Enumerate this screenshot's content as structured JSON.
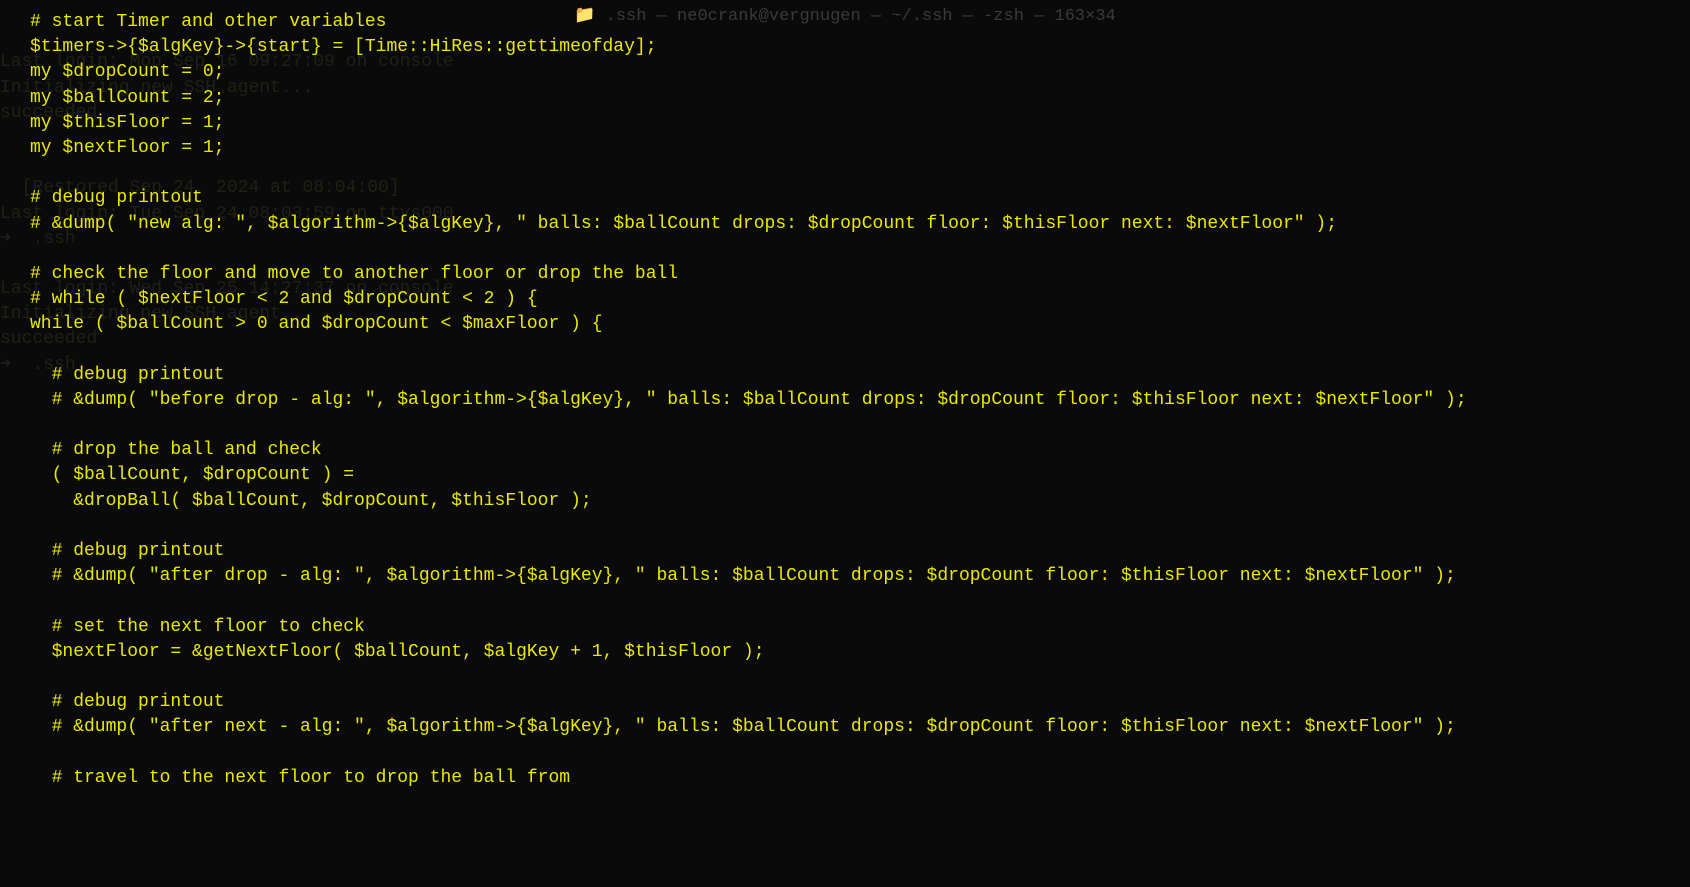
{
  "titleBar": "📁 .ssh — ne0crank@vergnugen — ~/.ssh — -zsh — 163×34",
  "backgroundLines": [
    "",
    "",
    "Last login: Mon Sep 16 09:27:09 on console",
    "Initializing new SSH agent...",
    "succeeded",
    "",
    "",
    "  [Restored Sep 24, 2024 at 08:04:00]",
    "Last login: Tue Sep 24 08:03:59 on ttys000",
    "➜  .ssh",
    "",
    "Last login: Wed Sep 25 14:27:37 on console",
    "Initializing new SSH agent...",
    "succeeded",
    "➜  .ssh"
  ],
  "codeLines": [
    "# start Timer and other variables",
    "$timers->{$algKey}->{start} = [Time::HiRes::gettimeofday];",
    "my $dropCount = 0;",
    "my $ballCount = 2;",
    "my $thisFloor = 1;",
    "my $nextFloor = 1;",
    "",
    "# debug printout",
    "# &dump( \"new alg: \", $algorithm->{$algKey}, \" balls: $ballCount drops: $dropCount floor: $thisFloor next: $nextFloor\" );",
    "",
    "# check the floor and move to another floor or drop the ball",
    "# while ( $nextFloor < 2 and $dropCount < 2 ) {",
    "while ( $ballCount > 0 and $dropCount < $maxFloor ) {",
    "",
    "  # debug printout",
    "  # &dump( \"before drop - alg: \", $algorithm->{$algKey}, \" balls: $ballCount drops: $dropCount floor: $thisFloor next: $nextFloor\" );",
    "",
    "  # drop the ball and check",
    "  ( $ballCount, $dropCount ) =",
    "    &dropBall( $ballCount, $dropCount, $thisFloor );",
    "",
    "  # debug printout",
    "  # &dump( \"after drop - alg: \", $algorithm->{$algKey}, \" balls: $ballCount drops: $dropCount floor: $thisFloor next: $nextFloor\" );",
    "",
    "  # set the next floor to check",
    "  $nextFloor = &getNextFloor( $ballCount, $algKey + 1, $thisFloor );",
    "",
    "  # debug printout",
    "  # &dump( \"after next - alg: \", $algorithm->{$algKey}, \" balls: $ballCount drops: $dropCount floor: $thisFloor next: $nextFloor\" );",
    "",
    "  # travel to the next floor to drop the ball from"
  ]
}
